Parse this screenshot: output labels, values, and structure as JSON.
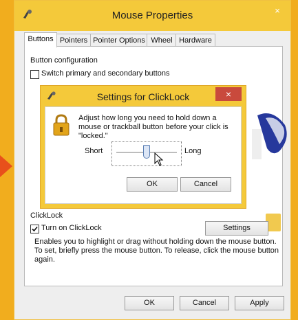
{
  "window": {
    "title": "Mouse Properties",
    "close_glyph": "×"
  },
  "tabs": [
    {
      "label": "Buttons"
    },
    {
      "label": "Pointers"
    },
    {
      "label": "Pointer Options"
    },
    {
      "label": "Wheel"
    },
    {
      "label": "Hardware"
    }
  ],
  "button_config": {
    "group_label": "Button configuration",
    "switch_label": "Switch primary and secondary buttons",
    "switch_checked": false
  },
  "clicklock": {
    "group_label": "ClickLock",
    "turn_on_label": "Turn on ClickLock",
    "turn_on_checked": true,
    "settings_button": "Settings",
    "description": "Enables you to highlight or drag without holding down the mouse button. To set, briefly press the mouse button. To release, click the mouse button again."
  },
  "dialog": {
    "title": "Settings for ClickLock",
    "close_glyph": "×",
    "text": "Adjust how long you need to hold down a mouse or trackball button before your click is \"locked.\"",
    "slider_min_label": "Short",
    "slider_max_label": "Long",
    "slider_value_fraction": 0.5,
    "ok_label": "OK",
    "cancel_label": "Cancel"
  },
  "footer": {
    "ok_label": "OK",
    "cancel_label": "Cancel",
    "apply_label": "Apply"
  },
  "colors": {
    "frame": "#f3b318",
    "titlebar": "#f4c93a",
    "close_red": "#c94a3c",
    "arrow": "#e8501b"
  }
}
